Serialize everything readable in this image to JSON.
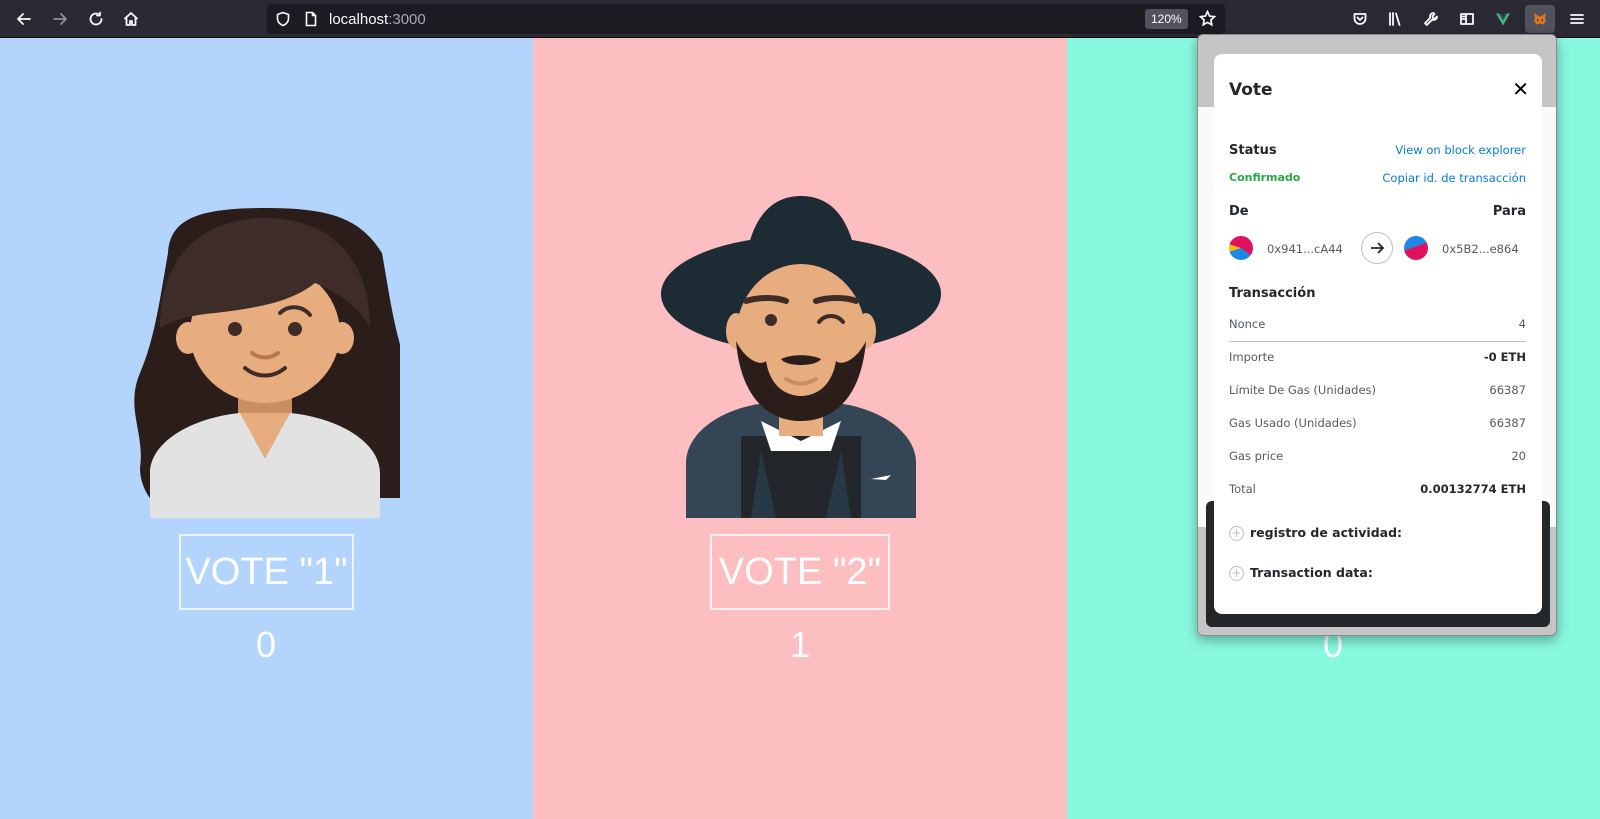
{
  "browser": {
    "url_host": "localhost",
    "url_port": ":3000",
    "zoom": "120%"
  },
  "candidates": [
    {
      "vote_label": "VOTE \"1\"",
      "count": "0",
      "bg": "#b3d4fc"
    },
    {
      "vote_label": "VOTE \"2\"",
      "count": "1",
      "bg": "#fdbec2"
    },
    {
      "count": "0",
      "bg": "#88f9df"
    }
  ],
  "metamask": {
    "title": "Vote",
    "status_heading": "Status",
    "view_explorer": "View on block explorer",
    "status_value": "Confirmado",
    "copy_tx_id": "Copiar id. de transacción",
    "from_label": "De",
    "to_label": "Para",
    "from_address": "0x941...cA44",
    "to_address": "0x5B2...e864",
    "transaction_heading": "Transacción",
    "rows": [
      {
        "label": "Nonce",
        "value": "4"
      },
      {
        "label": "Importe",
        "value": "-0 ETH"
      },
      {
        "label": "Límite De Gas (Unidades)",
        "value": "66387"
      },
      {
        "label": "Gas Usado (Unidades)",
        "value": "66387"
      },
      {
        "label": "Gas price",
        "value": "20"
      },
      {
        "label": "Total",
        "value": "0.00132774 ETH"
      }
    ],
    "activity_log": "registro de actividad:",
    "transaction_data": "Transaction data:",
    "colors": {
      "link": "#037dd6",
      "confirmed": "#28a745"
    }
  }
}
